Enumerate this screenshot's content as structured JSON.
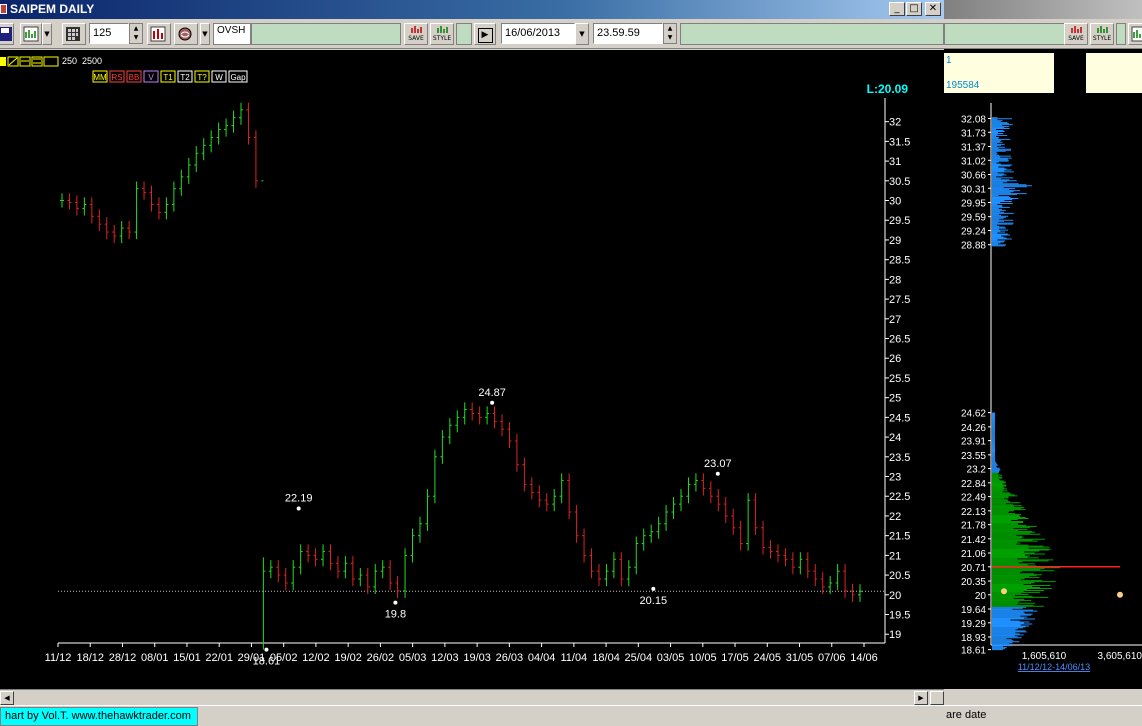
{
  "window": {
    "title": "SAIPEM DAILY",
    "controls": {
      "minimize": "_",
      "maximize": "□",
      "close": "✕"
    }
  },
  "toolbar": {
    "period_value": "125",
    "ovsh_label": "OVSH",
    "date_value": "16/06/2013",
    "time_value": "23.59.59",
    "save_label": "SAVE",
    "style_label": "STYLE"
  },
  "indicator_bar": {
    "row1": [
      "250",
      "2500"
    ],
    "row2_icons": [
      "MM",
      "RS",
      "BB",
      "V",
      "T1",
      "T2",
      "T?",
      "W",
      "Gap"
    ]
  },
  "chart_data": {
    "type": "ohlc",
    "last_label": "L:20.09",
    "ylim": [
      18.6,
      32.6
    ],
    "y_ticks": [
      19,
      19.5,
      20,
      20.5,
      21,
      21.5,
      22,
      22.5,
      23,
      23.5,
      24,
      24.5,
      25,
      25.5,
      26,
      26.5,
      27,
      27.5,
      28,
      28.5,
      29,
      29.5,
      30,
      30.5,
      31,
      31.5,
      32
    ],
    "x_ticks": [
      "11/12",
      "18/12",
      "28/12",
      "08/01",
      "15/01",
      "22/01",
      "29/01",
      "05/02",
      "12/02",
      "19/02",
      "26/02",
      "05/03",
      "12/03",
      "19/03",
      "26/03",
      "04/04",
      "11/04",
      "18/04",
      "25/04",
      "03/05",
      "10/05",
      "17/05",
      "24/05",
      "31/05",
      "07/06",
      "14/06"
    ],
    "reference_line": 20.09,
    "annotations": [
      {
        "label": "22.19",
        "date_index": 7,
        "value": 22.19,
        "position": "above"
      },
      {
        "label": "19.8",
        "date_index": 10,
        "value": 19.8,
        "position": "below"
      },
      {
        "label": "24.87",
        "date_index": 13,
        "value": 24.87,
        "position": "above"
      },
      {
        "label": "20.15",
        "date_index": 18,
        "value": 20.15,
        "position": "below"
      },
      {
        "label": "23.07",
        "date_index": 20,
        "value": 23.07,
        "position": "above"
      },
      {
        "label": "18.61",
        "date_index": 6,
        "value": 18.61,
        "position": "below"
      }
    ],
    "closes": [
      30.0,
      29.95,
      29.8,
      29.9,
      29.6,
      29.4,
      29.2,
      29.1,
      29.3,
      29.2,
      30.3,
      30.2,
      29.9,
      29.7,
      29.9,
      30.3,
      30.6,
      30.9,
      31.2,
      31.4,
      31.6,
      31.8,
      31.9,
      32.1,
      32.3,
      31.6,
      30.5,
      20.6,
      20.7,
      20.5,
      20.3,
      20.7,
      21.1,
      21.0,
      20.9,
      21.1,
      20.8,
      20.6,
      20.8,
      20.4,
      20.5,
      20.2,
      20.6,
      20.7,
      20.3,
      20.1,
      21.0,
      21.5,
      21.8,
      22.5,
      23.5,
      24.0,
      24.3,
      24.5,
      24.7,
      24.6,
      24.5,
      24.6,
      24.4,
      24.2,
      23.9,
      23.3,
      22.8,
      22.6,
      22.4,
      22.3,
      22.5,
      22.9,
      22.1,
      21.5,
      21.0,
      20.6,
      20.4,
      20.6,
      20.9,
      20.4,
      20.7,
      21.3,
      21.5,
      21.6,
      21.8,
      22.1,
      22.3,
      22.5,
      22.8,
      22.9,
      22.7,
      22.5,
      22.3,
      22.0,
      21.7,
      21.3,
      22.4,
      21.7,
      21.2,
      21.1,
      21.0,
      20.9,
      20.7,
      20.9,
      20.6,
      20.4,
      20.2,
      20.3,
      20.6,
      20.1,
      20.0,
      20.09
    ]
  },
  "volume_profile": {
    "info_line1": "1",
    "info_line2": "195584",
    "upper_levels": [
      "32.08",
      "31.73",
      "31.37",
      "31.02",
      "30.66",
      "30.31",
      "29.95",
      "29.59",
      "29.24",
      "28.88"
    ],
    "lower_levels": [
      "24.62",
      "24.26",
      "23.91",
      "23.55",
      "23.2",
      "22.84",
      "22.49",
      "22.13",
      "21.78",
      "21.42",
      "21.06",
      "20.71",
      "20.35",
      "20",
      "19.64",
      "19.29",
      "18.93",
      "18.61"
    ],
    "x_labels": [
      "1,605,610",
      "3,605,610"
    ],
    "range_label": "11/12/12-14/06/13",
    "poc": 20.71,
    "colors": {
      "upper": "#1e90ff",
      "lower": "#00a000",
      "poc": "#ff2020"
    }
  },
  "status": {
    "left": "hart by Vol.T. www.thehawktrader.com",
    "right": "are date"
  }
}
